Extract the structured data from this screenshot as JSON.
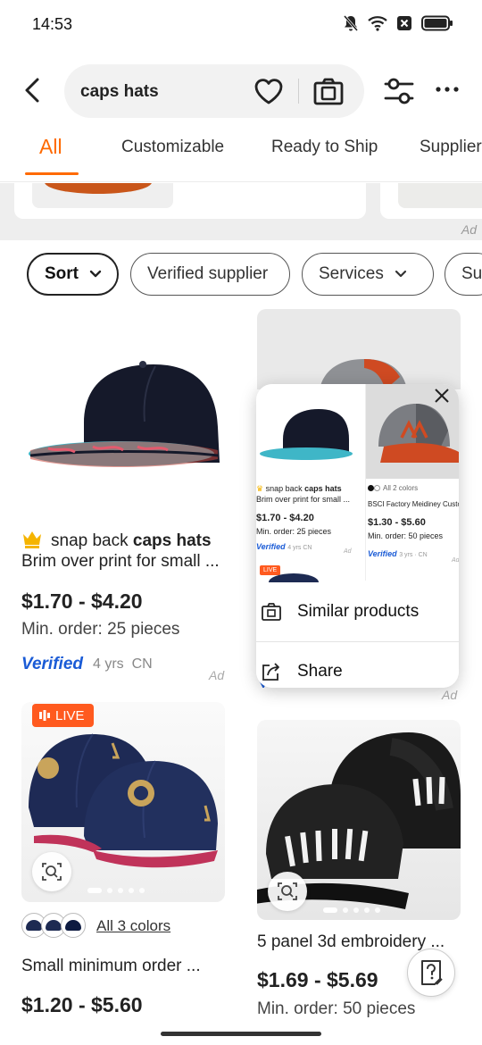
{
  "status_bar": {
    "time": "14:53",
    "icons": [
      "bell-muted-icon",
      "wifi-icon",
      "sim-off-icon",
      "battery-icon"
    ]
  },
  "search": {
    "query": "caps hats",
    "icons": [
      "back-arrow-icon",
      "heart-icon",
      "camera-icon",
      "filter-sliders-icon",
      "more-dots-icon"
    ]
  },
  "tabs": [
    {
      "label": "All",
      "active": true
    },
    {
      "label": "Customizable"
    },
    {
      "label": "Ready to Ship"
    },
    {
      "label": "Supplier"
    }
  ],
  "strip": {
    "ad_label": "Ad"
  },
  "chips": [
    {
      "label": "Sort",
      "selected": true,
      "has_chevron": true
    },
    {
      "label": "Verified supplier"
    },
    {
      "label": "Services",
      "has_chevron": true
    },
    {
      "label": "Su"
    }
  ],
  "products": [
    {
      "title_prefix": "snap back",
      "title_bold": "caps hats",
      "subtitle": "Brim over print for small ...",
      "price": "$1.70 - $4.20",
      "min_order": "Min. order: 25 pieces",
      "verified": "Verified",
      "years": "4 yrs",
      "country": "CN",
      "ad": "Ad"
    },
    {
      "ad": "Ad"
    },
    {
      "live": "LIVE",
      "colors_link": "All 3 colors",
      "title": "Small minimum order ...",
      "price": "$1.20 - $5.60"
    },
    {
      "title": "5 panel 3d embroidery ...",
      "price": "$1.69 - $5.69",
      "min_order": "Min. order: 50 pieces"
    }
  ],
  "popup": {
    "preview_a": {
      "title_prefix": "snap back",
      "title_bold": "caps hats",
      "subtitle": "Brim over print for small ...",
      "price": "$1.70 - $4.20",
      "min_order": "Min. order: 25 pieces",
      "verified": "Verified",
      "years": "4 yrs CN",
      "ad": "Ad",
      "live": "LIVE"
    },
    "preview_b": {
      "colors": "All 2 colors",
      "title": "BSCI Factory Meidiney Custo...",
      "price": "$1.30 - $5.60",
      "min_order": "Min. order: 50 pieces",
      "verified": "Verified",
      "years": "3 yrs · CN",
      "ad": "Ad"
    },
    "menu": [
      {
        "label": "Similar products",
        "icon": "camera-search-icon"
      },
      {
        "label": "Share",
        "icon": "share-icon"
      }
    ]
  },
  "colors": {
    "accent": "#ff6a00",
    "verified_blue": "#1a5bd6",
    "live_orange": "#ff5a1f"
  }
}
